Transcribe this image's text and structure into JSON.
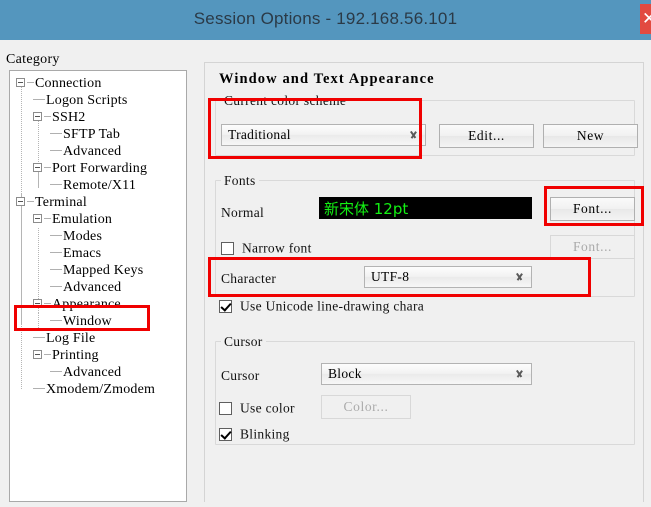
{
  "window": {
    "title": "Session Options - 192.168.56.101",
    "close_label": "✕",
    "titlebar_color": "#5496be",
    "close_button_color": "#e24a40"
  },
  "sidebar": {
    "heading": "Category",
    "items": [
      {
        "label": "Connection",
        "indent": 0,
        "expander": true,
        "selected": false
      },
      {
        "label": "Logon Scripts",
        "indent": 1,
        "expander": false,
        "selected": false
      },
      {
        "label": "SSH2",
        "indent": 1,
        "expander": true,
        "selected": false
      },
      {
        "label": "SFTP Tab",
        "indent": 2,
        "expander": false,
        "selected": false
      },
      {
        "label": "Advanced",
        "indent": 2,
        "expander": false,
        "selected": false
      },
      {
        "label": "Port Forwarding",
        "indent": 1,
        "expander": true,
        "selected": false
      },
      {
        "label": "Remote/X11",
        "indent": 2,
        "expander": false,
        "selected": false
      },
      {
        "label": "Terminal",
        "indent": 0,
        "expander": true,
        "selected": false
      },
      {
        "label": "Emulation",
        "indent": 1,
        "expander": true,
        "selected": false
      },
      {
        "label": "Modes",
        "indent": 2,
        "expander": false,
        "selected": false
      },
      {
        "label": "Emacs",
        "indent": 2,
        "expander": false,
        "selected": false
      },
      {
        "label": "Mapped Keys",
        "indent": 2,
        "expander": false,
        "selected": false
      },
      {
        "label": "Advanced",
        "indent": 2,
        "expander": false,
        "selected": false
      },
      {
        "label": "Appearance",
        "indent": 1,
        "expander": true,
        "selected": true
      },
      {
        "label": "Window",
        "indent": 2,
        "expander": false,
        "selected": false
      },
      {
        "label": "Log File",
        "indent": 1,
        "expander": false,
        "selected": false
      },
      {
        "label": "Printing",
        "indent": 1,
        "expander": true,
        "selected": false
      },
      {
        "label": "Advanced",
        "indent": 2,
        "expander": false,
        "selected": false
      },
      {
        "label": "Xmodem/Zmodem",
        "indent": 1,
        "expander": false,
        "selected": false
      }
    ]
  },
  "panel": {
    "title": "Window and Text Appearance",
    "color_scheme": {
      "legend": "Current color scheme",
      "value": "Traditional",
      "edit_button": "Edit...",
      "new_button": "New"
    },
    "fonts": {
      "legend": "Fonts",
      "normal_label": "Normal",
      "normal_preview_text": "新宋体 12pt",
      "normal_preview_fg": "#13f013",
      "normal_preview_bg": "#000000",
      "normal_font_button": "Font...",
      "narrow_checkbox_label": "Narrow font",
      "narrow_checked": false,
      "narrow_font_button": "Font...",
      "character_label": "Character",
      "character_value": "UTF-8",
      "unicode_checkbox_label": "Use Unicode line-drawing chara",
      "unicode_checked": true
    },
    "cursor": {
      "legend": "Cursor",
      "cursor_label": "Cursor",
      "cursor_value": "Block",
      "use_color_label": "Use color",
      "use_color_checked": false,
      "color_button": "Color...",
      "blinking_label": "Blinking",
      "blinking_checked": true
    }
  },
  "annotations": {
    "highlight_color": "#f00000",
    "boxes": [
      {
        "name": "color-scheme-highlight"
      },
      {
        "name": "font-button-highlight"
      },
      {
        "name": "character-highlight"
      },
      {
        "name": "appearance-node-highlight"
      }
    ]
  }
}
